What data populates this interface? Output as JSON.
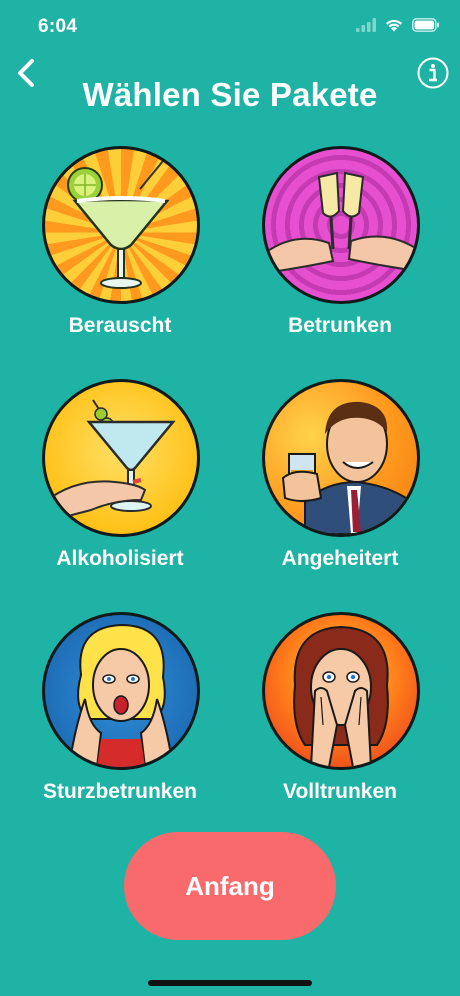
{
  "status": {
    "time": "6:04",
    "icons": [
      "signal-icon",
      "wifi-icon",
      "battery-icon"
    ]
  },
  "nav": {
    "back_icon": "chevron-left-icon",
    "info_icon": "info-icon"
  },
  "title": "Wählen Sie Pakete",
  "packages": [
    {
      "label": "Berauscht",
      "image": "margarita-cocktail"
    },
    {
      "label": "Betrunken",
      "image": "champagne-toast"
    },
    {
      "label": "Alkoholisiert",
      "image": "martini-glass-hand"
    },
    {
      "label": "Angeheitert",
      "image": "man-with-whiskey"
    },
    {
      "label": "Sturzbetrunken",
      "image": "shocked-blonde-woman"
    },
    {
      "label": "Volltrunken",
      "image": "woman-covering-face"
    }
  ],
  "start_label": "Anfang",
  "colors": {
    "background": "#1fb3a5",
    "button": "#f96a6c",
    "text": "#ffffff"
  }
}
